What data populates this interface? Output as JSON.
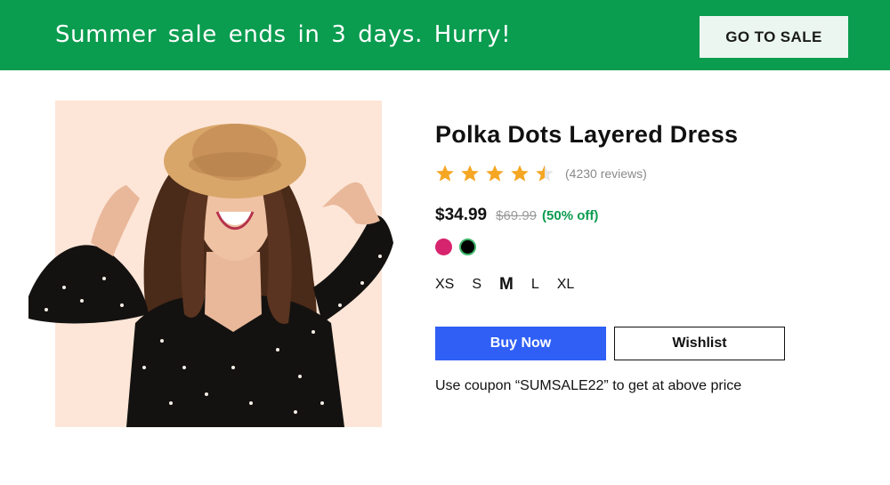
{
  "banner": {
    "message": "Summer sale ends in 3 days. Hurry!",
    "cta_label": "GO TO SALE",
    "background_color": "#0a9c4f"
  },
  "product": {
    "image_icon": "product-photo-woman-in-hat",
    "title": "Polka Dots Layered Dress",
    "rating": 4.5,
    "rating_max": 5,
    "reviews_label": "(4230 reviews)",
    "price": "$34.99",
    "original_price": "$69.99",
    "discount": "(50% off)",
    "colors": [
      {
        "name": "pink",
        "hex": "#d6246e",
        "selected": false
      },
      {
        "name": "black",
        "hex": "#000000",
        "selected": true
      }
    ],
    "sizes": [
      "XS",
      "S",
      "M",
      "L",
      "XL"
    ],
    "selected_size": "M"
  },
  "actions": {
    "buy_label": "Buy Now",
    "wishlist_label": "Wishlist",
    "buy_color": "#2f5ff5"
  },
  "coupon": {
    "text": "Use coupon “SUMSALE22” to get at above price"
  }
}
